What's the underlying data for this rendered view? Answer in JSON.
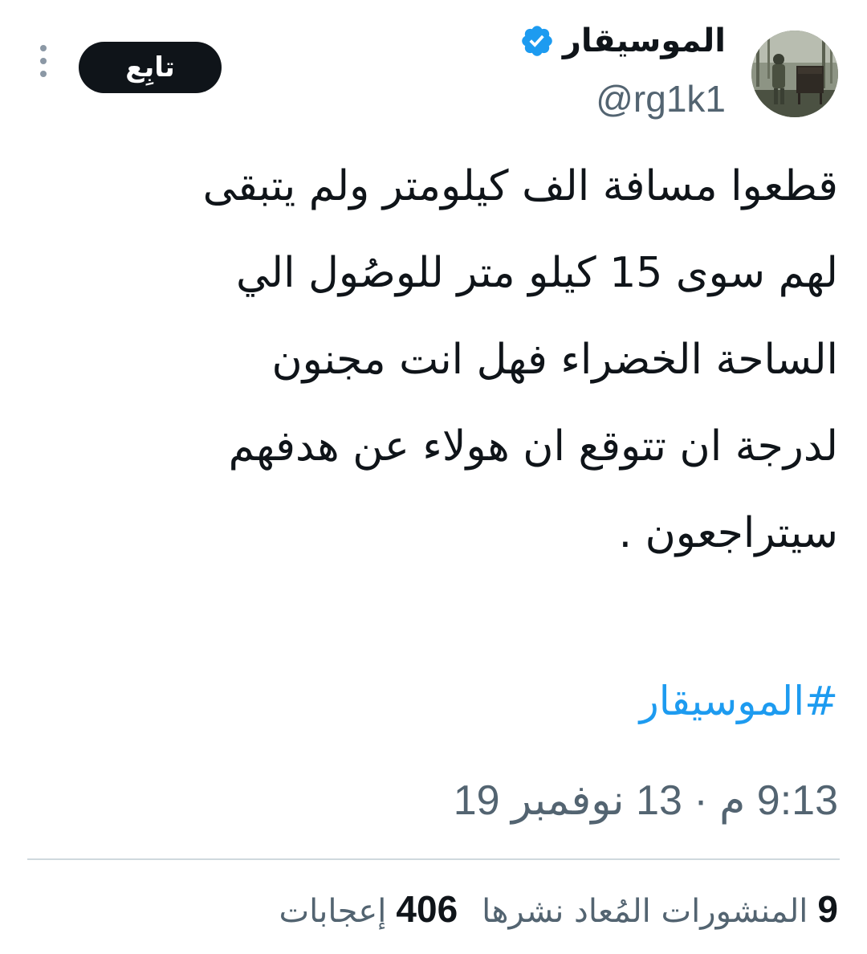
{
  "author": {
    "display_name": "الموسيقار",
    "handle": "@rg1k1",
    "verified_icon": "verified-badge-icon",
    "avatar_icon": "avatar-photo"
  },
  "header": {
    "follow_label": "تابِع",
    "more_icon": "more-vertical-icon"
  },
  "tweet": {
    "text": "قطعوا مسافة الف كيلومتر ولم يتبقى\nلهم سوى 15 كيلو متر للوصُول الي\nالساحة الخضراء فهل انت مجنون\nلدرجة ان تتوقع ان هولاء عن هدفهم\nسيتراجعون .",
    "hashtag": "#الموسيقار",
    "timestamp": "9:13 م · 13 نوفمبر 19"
  },
  "stats": {
    "retweets_count": "9",
    "retweets_label": "المنشورات المُعاد نشرها",
    "likes_count": "406",
    "likes_label": "إعجابات"
  },
  "colors": {
    "text": "#0f1419",
    "secondary": "#536471",
    "link": "#1d9bf0",
    "verified": "#1d9bf0",
    "divider": "#cfd9de",
    "follow_bg": "#0f1419"
  }
}
